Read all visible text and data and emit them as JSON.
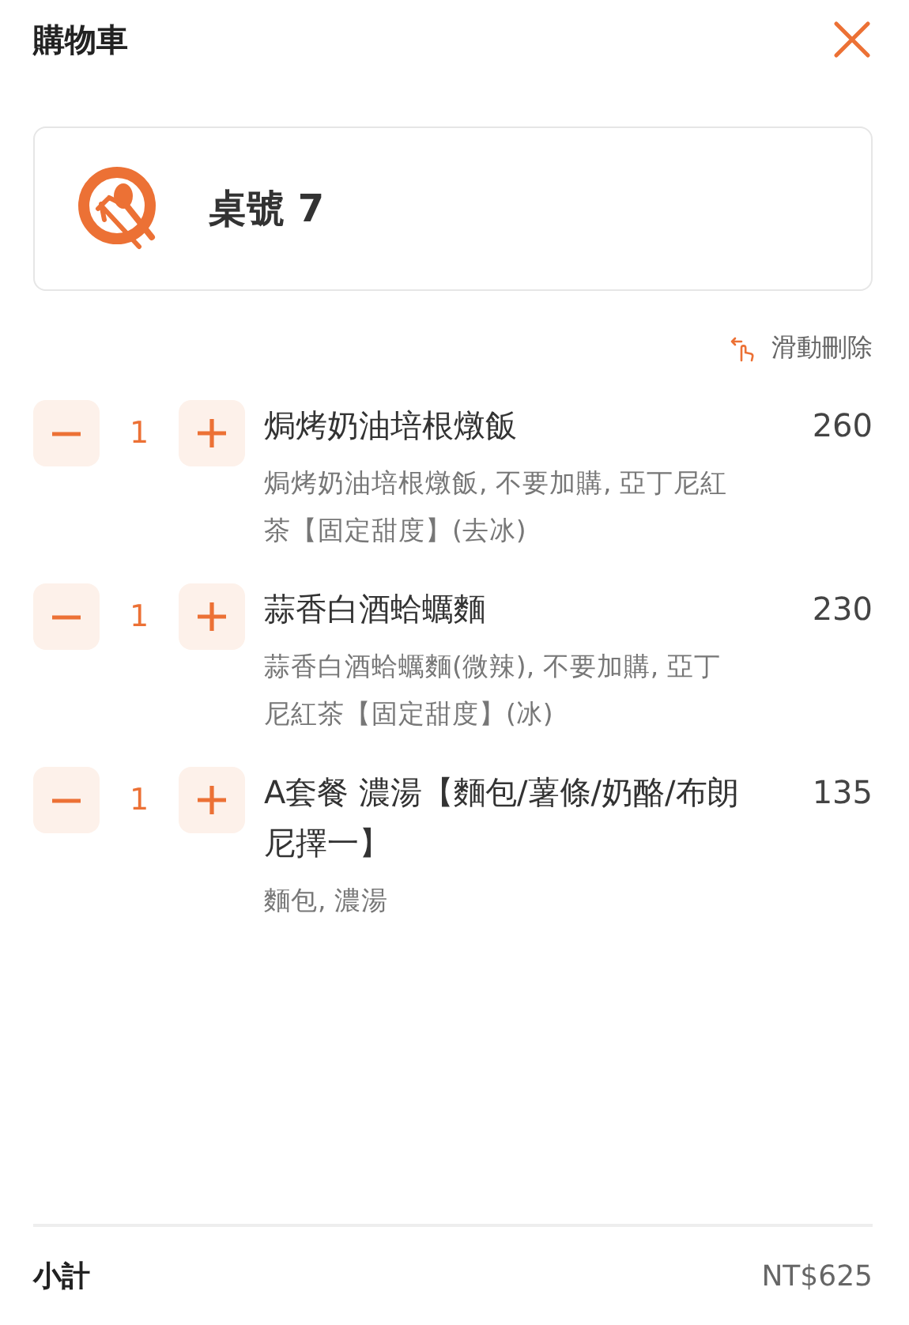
{
  "header": {
    "title": "購物車"
  },
  "table_card": {
    "label": "桌號 7"
  },
  "swipe_hint": {
    "label": "滑動刪除"
  },
  "items": [
    {
      "quantity": "1",
      "name": "焗烤奶油培根燉飯",
      "options": "焗烤奶油培根燉飯, 不要加購, 亞丁尼紅茶【固定甜度】(去冰)",
      "price": "260"
    },
    {
      "quantity": "1",
      "name": "蒜香白酒蛤蠣麵",
      "options": "蒜香白酒蛤蠣麵(微辣), 不要加購, 亞丁尼紅茶【固定甜度】(冰)",
      "price": "230"
    },
    {
      "quantity": "1",
      "name": "A套餐 濃湯【麵包/薯條/奶酪/布朗尼擇一】",
      "options": "麵包, 濃湯",
      "price": "135"
    }
  ],
  "subtotal": {
    "label": "小計",
    "amount": "NT$625"
  }
}
